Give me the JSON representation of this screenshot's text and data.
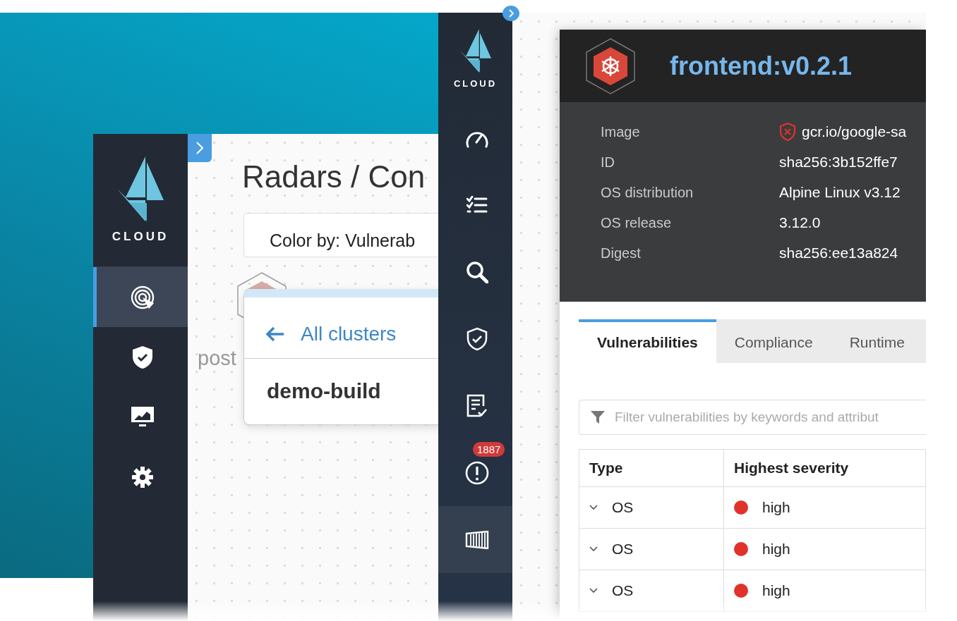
{
  "back_window": {
    "sidebar": {
      "logo_text": "CLOUD",
      "items": [
        {
          "kind": "radar",
          "selected": true
        },
        {
          "kind": "shield",
          "selected": false
        },
        {
          "kind": "monitor",
          "selected": false
        },
        {
          "kind": "gear",
          "selected": false
        }
      ]
    },
    "title": "Radars / Con",
    "color_by": "Color by: Vulnerab",
    "node_label": "post",
    "cluster_card": {
      "back_link": "All clusters",
      "cluster": "demo-build"
    }
  },
  "front_window": {
    "sidebar": {
      "logo_text": "CLOUD",
      "items": [
        {
          "kind": "gauge",
          "selected": false
        },
        {
          "kind": "checklist",
          "selected": false
        },
        {
          "kind": "search",
          "selected": false
        },
        {
          "kind": "shield-check",
          "selected": false
        },
        {
          "kind": "report",
          "selected": false
        },
        {
          "kind": "alert",
          "selected": false,
          "badge": "1887"
        },
        {
          "kind": "container",
          "selected": true
        }
      ]
    },
    "image_panel": {
      "title": "frontend:v0.2.1",
      "details": [
        {
          "label": "Image",
          "value": "gcr.io/google-sa",
          "flagged": true
        },
        {
          "label": "ID",
          "value": "sha256:3b152ffe7",
          "flagged": false
        },
        {
          "label": "OS distribution",
          "value": "Alpine Linux v3.12",
          "flagged": false
        },
        {
          "label": "OS release",
          "value": "3.12.0",
          "flagged": false
        },
        {
          "label": "Digest",
          "value": "sha256:ee13a824",
          "flagged": false
        }
      ],
      "tabs": [
        {
          "label": "Vulnerabilities",
          "selected": true
        },
        {
          "label": "Compliance",
          "selected": false
        },
        {
          "label": "Runtime",
          "selected": false
        }
      ],
      "filter": {
        "placeholder": "Filter vulnerabilities by keywords and attribut"
      },
      "table": {
        "columns": [
          "Type",
          "Highest severity"
        ],
        "rows": [
          {
            "type": "OS",
            "severity": "high",
            "color": "#e0322b"
          },
          {
            "type": "OS",
            "severity": "high",
            "color": "#e0322b"
          },
          {
            "type": "OS",
            "severity": "high",
            "color": "#e0322b"
          }
        ]
      }
    }
  }
}
